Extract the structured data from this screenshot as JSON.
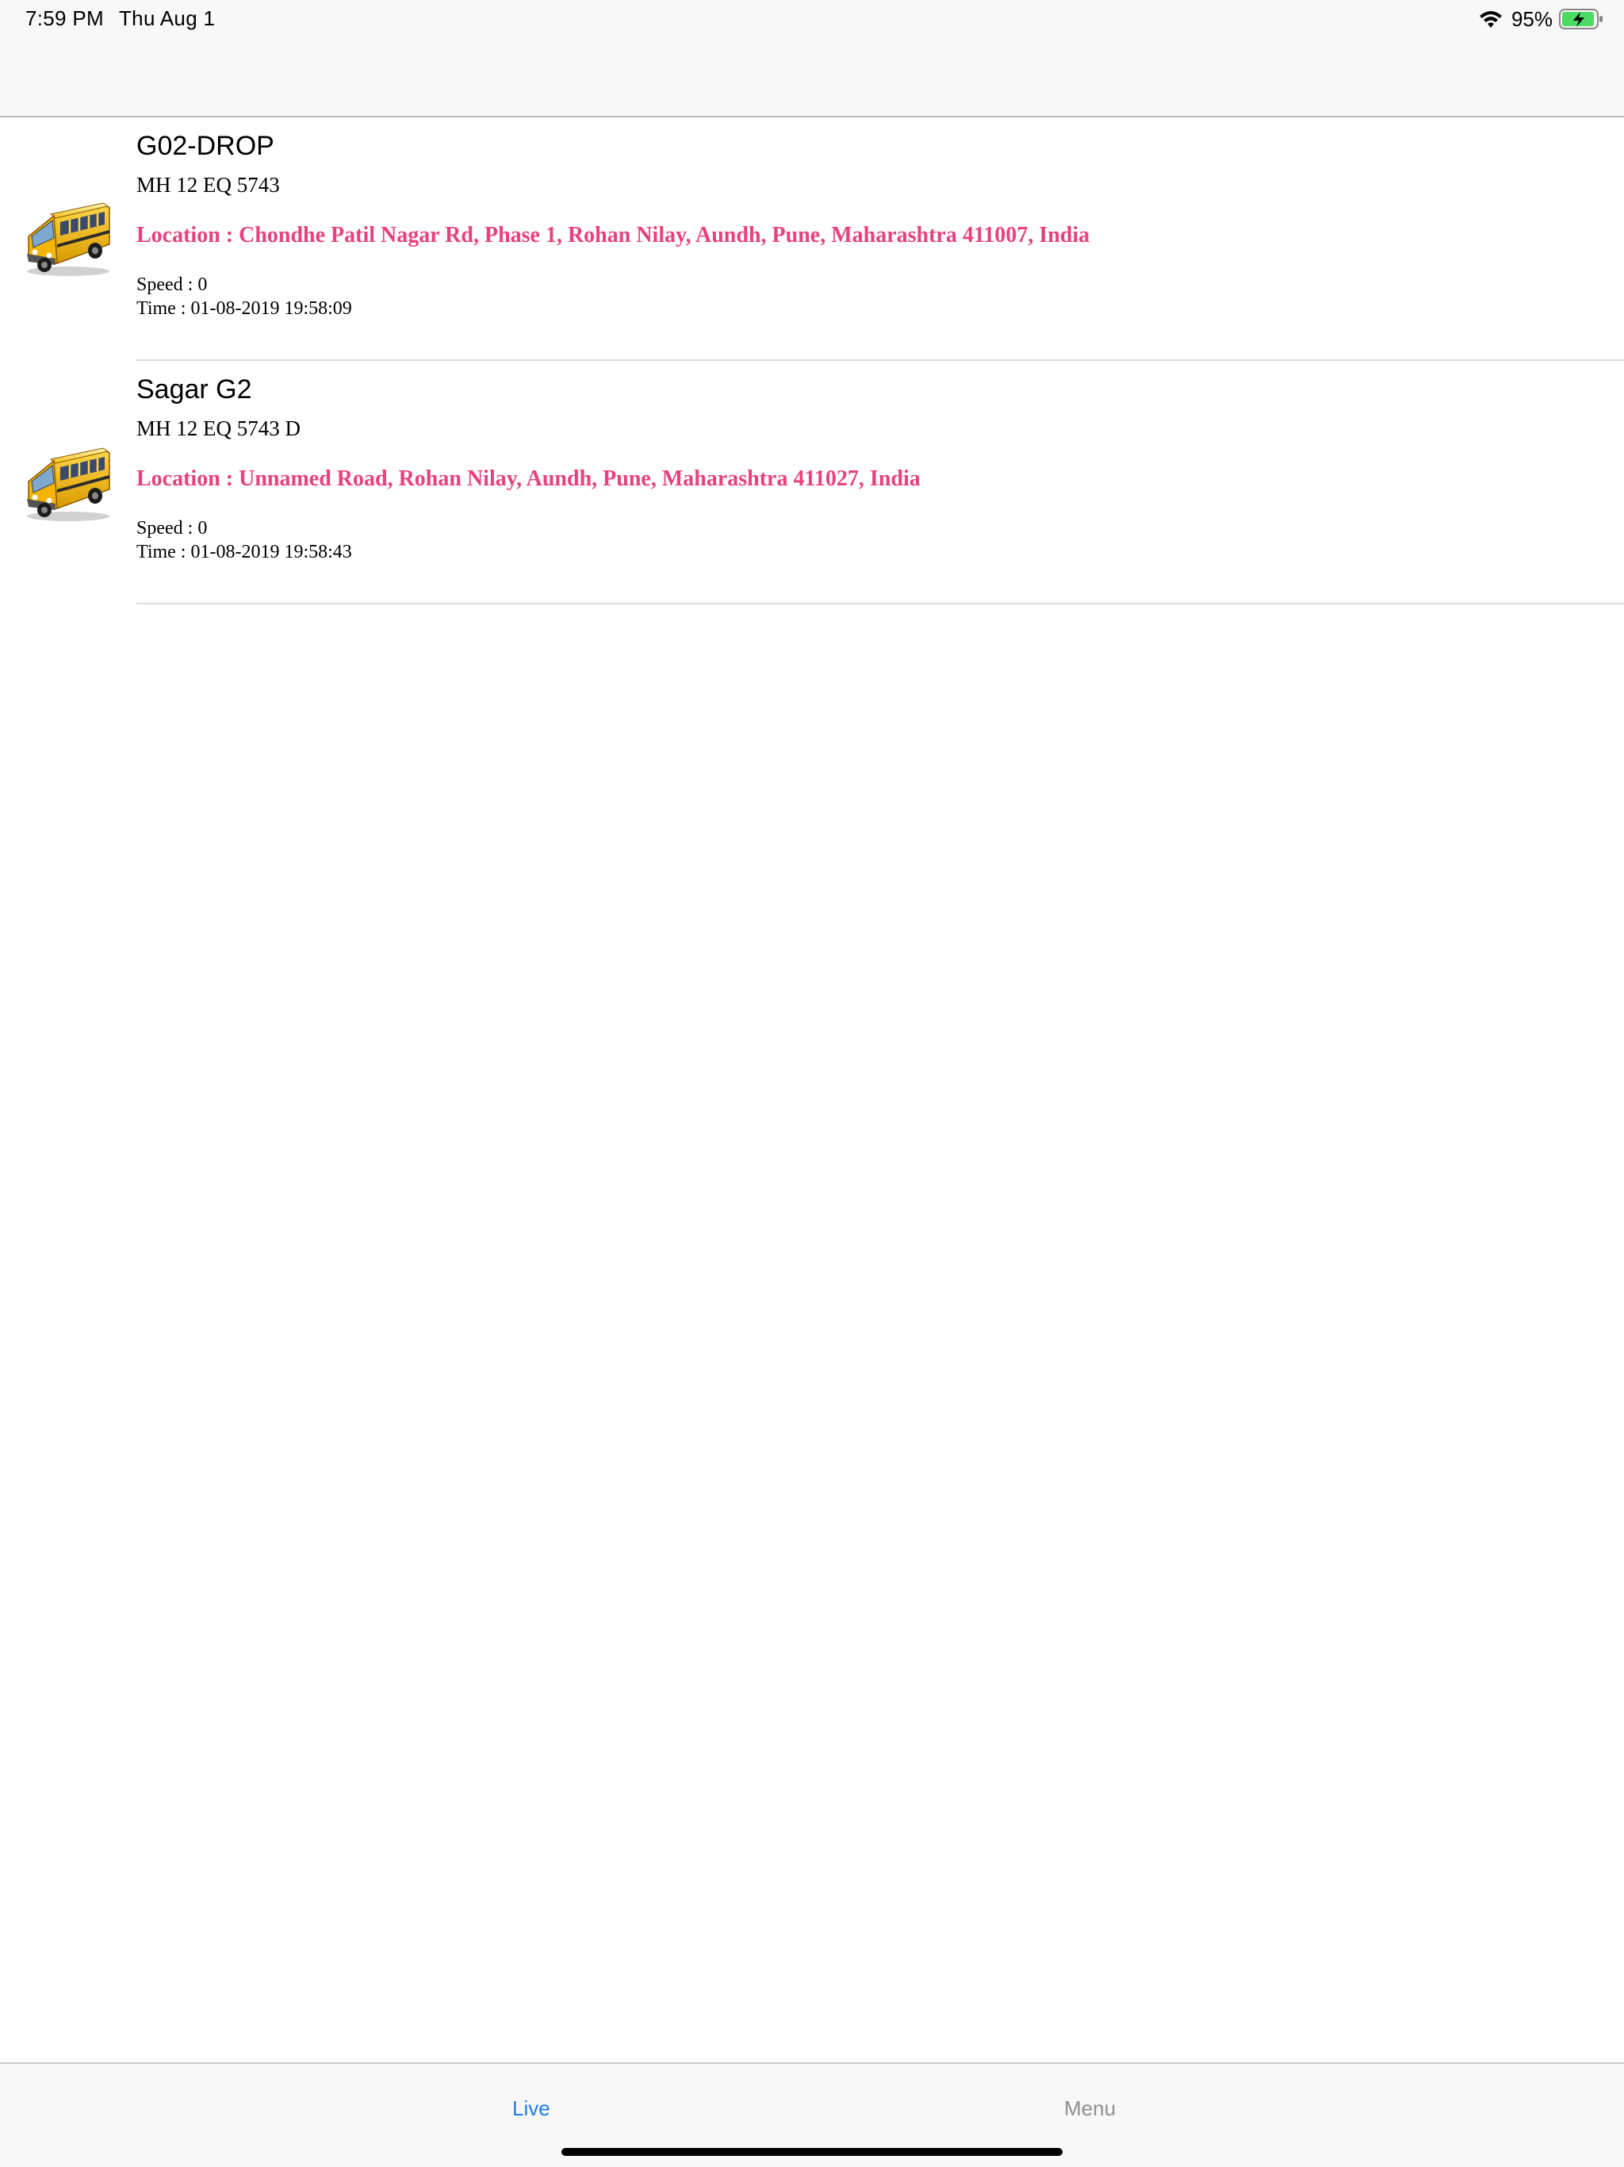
{
  "status_bar": {
    "time": "7:59 PM",
    "date": "Thu Aug 1",
    "battery_percent": "95%",
    "battery_level": 0.95,
    "battery_charging": true,
    "icons": [
      "wifi-icon",
      "battery-charging-icon"
    ]
  },
  "vehicles": [
    {
      "icon": "school-bus-icon",
      "name": "G02-DROP",
      "registration": "MH 12 EQ 5743",
      "location": "Location : Chondhe Patil Nagar Rd, Phase 1, Rohan Nilay, Aundh, Pune, Maharashtra 411007, India",
      "speed": "Speed : 0",
      "time": "Time : 01-08-2019 19:58:09"
    },
    {
      "icon": "school-bus-icon",
      "name": "Sagar G2",
      "registration": "MH 12 EQ 5743 D",
      "location": "Location : Unnamed Road, Rohan Nilay, Aundh, Pune, Maharashtra 411027, India",
      "speed": "Speed : 0",
      "time": "Time : 01-08-2019 19:58:43"
    }
  ],
  "tab_bar": {
    "tabs": [
      {
        "label": "Live",
        "selected": true
      },
      {
        "label": "Menu",
        "selected": false
      }
    ]
  },
  "colors": {
    "location_text": "#e8417f",
    "tab_selected": "#1d7ee4",
    "tab_unselected": "#8e8e93",
    "bar_background": "#f8f8f8",
    "bus_body": "#f2b705"
  }
}
